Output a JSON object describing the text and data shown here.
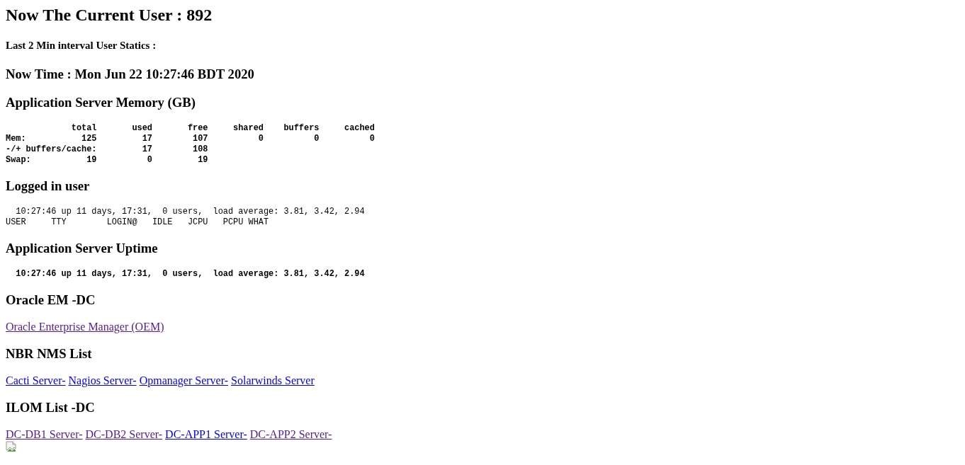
{
  "blocks": [
    {
      "kind": "title",
      "text": "Now The Current User : 892"
    },
    {
      "kind": "subheading",
      "text": "Last 2 Min interval User Statics :"
    },
    {
      "kind": "heading",
      "text": "Now Time : Mon Jun 22 10:27:46 BDT 2020"
    },
    {
      "kind": "heading",
      "text": "Application Server Memory (GB)"
    },
    {
      "kind": "console",
      "bold": true,
      "lines": [
        "             total       used       free     shared    buffers     cached",
        "Mem:           125         17        107          0          0          0",
        "-/+ buffers/cache:         17        108",
        "Swap:           19          0         19"
      ]
    },
    {
      "kind": "heading",
      "text": "Logged in user"
    },
    {
      "kind": "console",
      "bold": false,
      "lines": [
        "  10:27:46 up 11 days, 17:31,  0 users,  load average: 3.81, 3.42, 2.94",
        "USER     TTY        LOGIN@   IDLE   JCPU   PCPU WHAT"
      ]
    },
    {
      "kind": "heading",
      "text": "Application Server Uptime"
    },
    {
      "kind": "console",
      "bold": true,
      "lines": [
        "  10:27:46 up 11 days, 17:31,  0 users,  load average: 3.81, 3.42, 2.94"
      ]
    },
    {
      "kind": "heading",
      "text": "Oracle EM -DC"
    },
    {
      "kind": "links",
      "links": [
        {
          "text": "Oracle Enterprise Manager (OEM)",
          "visited": true
        }
      ]
    },
    {
      "kind": "heading",
      "text": "NBR NMS List"
    },
    {
      "kind": "links",
      "links": [
        {
          "text": "Cacti Server-",
          "visited": false
        },
        {
          "text": "Nagios Server-",
          "visited": false
        },
        {
          "text": "Opmanager Server-",
          "visited": false
        },
        {
          "text": "Solarwinds Server",
          "visited": false
        }
      ]
    },
    {
      "kind": "heading",
      "text": "ILOM List -DC"
    },
    {
      "kind": "links",
      "links": [
        {
          "text": "DC-DB1 Server-",
          "visited": true
        },
        {
          "text": "DC-DB2 Server-",
          "visited": true
        },
        {
          "text": "DC-APP1 Server-",
          "visited": false
        },
        {
          "text": "DC-APP2 Server-",
          "visited": true
        }
      ]
    },
    {
      "kind": "broken-image"
    }
  ]
}
